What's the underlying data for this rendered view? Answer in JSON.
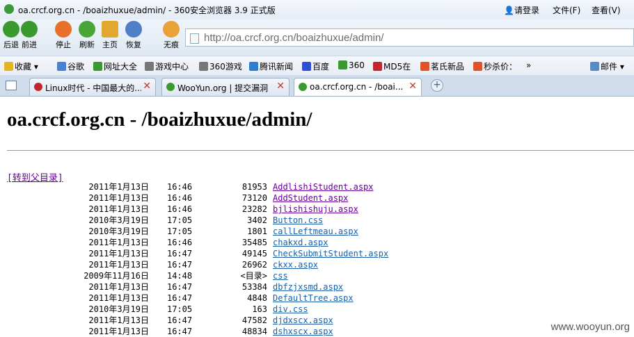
{
  "window": {
    "title": "oa.crcf.org.cn - /boaizhuxue/admin/ - 360安全浏览器 3.9 正式版",
    "menu": [
      "请登录",
      "文件(F)",
      "查看(V)"
    ]
  },
  "toolbar": {
    "buttons": [
      {
        "label": "后退",
        "icon": "back-arrow-icon",
        "color": "#3b9a2f"
      },
      {
        "label": "前进",
        "icon": "forward-arrow-icon",
        "color": "#3b9a2f"
      },
      {
        "label": "停止",
        "icon": "stop-icon",
        "color": "#e8702a"
      },
      {
        "label": "刷新",
        "icon": "refresh-icon",
        "color": "#4aa537"
      },
      {
        "label": "主页",
        "icon": "home-icon",
        "color": "#e2a72e"
      },
      {
        "label": "恢复",
        "icon": "undo-icon",
        "color": "#4f7fc7"
      },
      {
        "label": "无痕",
        "icon": "paw-icon",
        "color": "#e9a13a"
      }
    ],
    "address": "http://oa.crcf.org.cn/boaizhuxue/admin/"
  },
  "bookmarks": [
    {
      "label": "收藏",
      "color": "#e5b323"
    },
    {
      "label": "谷歌",
      "color": "#4a7fd1"
    },
    {
      "label": "网址大全",
      "color": "#3b9a2f"
    },
    {
      "label": "游戏中心",
      "color": "#777777"
    },
    {
      "label": "360游戏",
      "color": "#777777"
    },
    {
      "label": "腾讯新闻",
      "color": "#2e7dd1"
    },
    {
      "label": "百度",
      "color": "#2e4fd1"
    },
    {
      "label": "360",
      "color": "#3b9a2f"
    },
    {
      "label": "MD5在",
      "color": "#c0282d"
    },
    {
      "label": "茗氏新品",
      "color": "#e0522b"
    },
    {
      "label": "秒杀价：",
      "color": "#e0522b"
    },
    {
      "label": "»",
      "color": ""
    },
    {
      "label": "邮件",
      "color": "#5a8bc4"
    }
  ],
  "tabs": [
    {
      "label": "Linux时代 - 中国最大的...",
      "active": false
    },
    {
      "label": "WooYun.org | 提交漏洞",
      "active": false
    },
    {
      "label": "oa.crcf.org.cn - /boai...",
      "active": true
    }
  ],
  "page": {
    "heading": "oa.crcf.org.cn - /boaizhuxue/admin/",
    "parent_link": "[转到父目录]",
    "entries": [
      {
        "date": "2011年1月13日",
        "time": "16:46",
        "size": "81953",
        "name": "AddlishiStudent.aspx",
        "visited": true
      },
      {
        "date": "2011年1月13日",
        "time": "16:46",
        "size": "73120",
        "name": "AddStudent.aspx",
        "visited": true
      },
      {
        "date": "2011年1月13日",
        "time": "16:46",
        "size": "23282",
        "name": "bjlishishuju.aspx",
        "visited": true
      },
      {
        "date": "2010年3月19日",
        "time": "17:05",
        "size": "3402",
        "name": "Button.css",
        "visited": false
      },
      {
        "date": "2010年3月19日",
        "time": "17:05",
        "size": "1801",
        "name": "callLeftmeau.aspx",
        "visited": false
      },
      {
        "date": "2011年1月13日",
        "time": "16:46",
        "size": "35485",
        "name": "chakxd.aspx",
        "visited": false
      },
      {
        "date": "2011年1月13日",
        "time": "16:47",
        "size": "49145",
        "name": "CheckSubmitStudent.aspx",
        "visited": false
      },
      {
        "date": "2011年1月13日",
        "time": "16:47",
        "size": "26962",
        "name": "ckxx.aspx",
        "visited": false
      },
      {
        "date": "2009年11月16日",
        "time": "14:48",
        "size": "<目录>",
        "name": "css",
        "visited": false
      },
      {
        "date": "2011年1月13日",
        "time": "16:47",
        "size": "53384",
        "name": "dbfzjxsmd.aspx",
        "visited": false
      },
      {
        "date": "2011年1月13日",
        "time": "16:47",
        "size": "4848",
        "name": "DefaultTree.aspx",
        "visited": false
      },
      {
        "date": "2010年3月19日",
        "time": "17:05",
        "size": "163",
        "name": "div.css",
        "visited": false
      },
      {
        "date": "2011年1月13日",
        "time": "16:47",
        "size": "47582",
        "name": "djdxscx.aspx",
        "visited": false
      },
      {
        "date": "2011年1月13日",
        "time": "16:47",
        "size": "48834",
        "name": "dshxscx.aspx",
        "visited": false
      }
    ]
  },
  "watermark": "www.wooyun.org"
}
